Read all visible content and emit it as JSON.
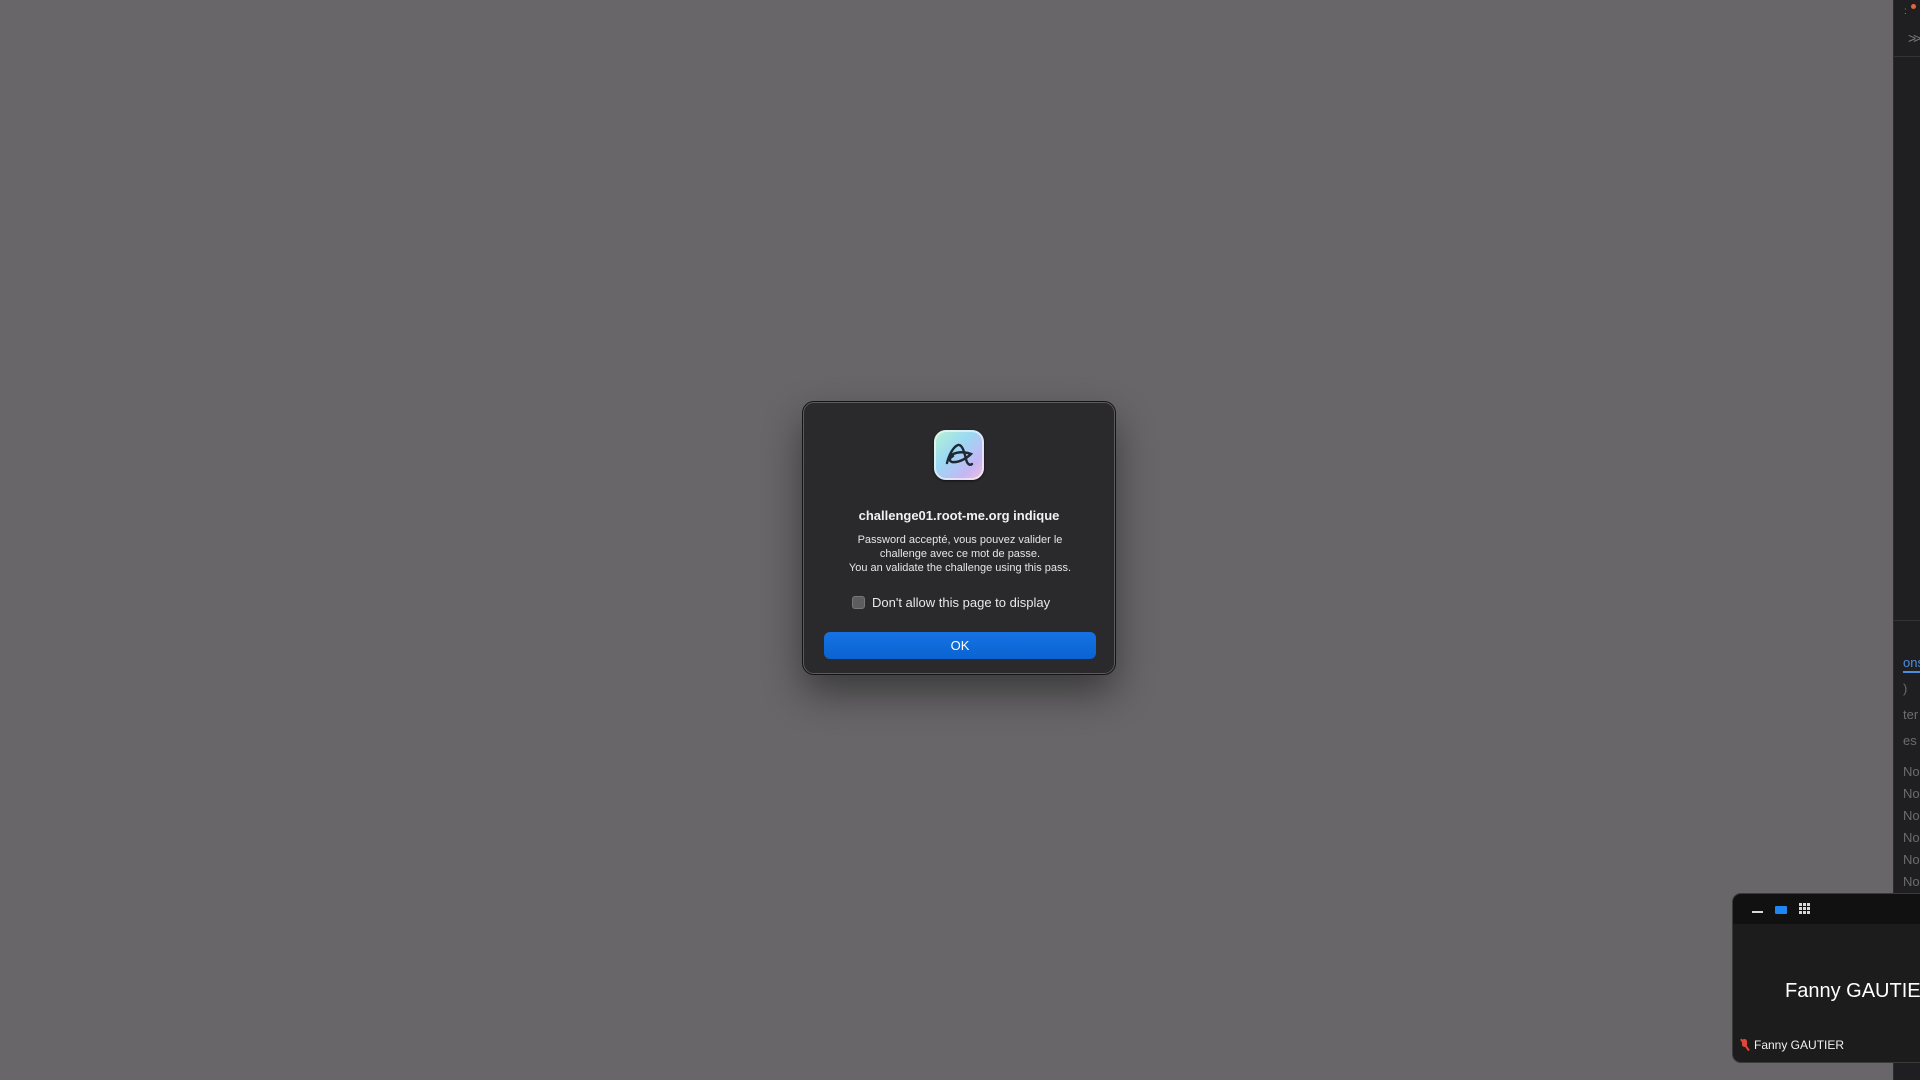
{
  "dialog": {
    "icon": "arc-browser-icon",
    "title": "challenge01.root-me.org indique",
    "message_lines": [
      "Password accepté, vous pouvez valider le",
      "challenge avec ce mot de passe.",
      "You an validate the challenge using this pass."
    ],
    "checkbox_label": "Don't allow this page to display",
    "checkbox_checked": false,
    "ok_label": "OK",
    "accent_color": "#0a63d1"
  },
  "side_panel": {
    "fragments": [
      "ons",
      ")",
      "ter",
      "es",
      "No",
      "No",
      "No",
      "No",
      "No",
      "No"
    ],
    "accent_color": "#4a8ee0"
  },
  "meeting": {
    "toolbar_icons": [
      "minimize-icon",
      "speaker-view-icon",
      "gallery-view-icon"
    ],
    "participant_name": "Fanny GAUTIER",
    "footer_name": "Fanny GAUTIER",
    "footer_icon": "microphone-muted-icon"
  }
}
